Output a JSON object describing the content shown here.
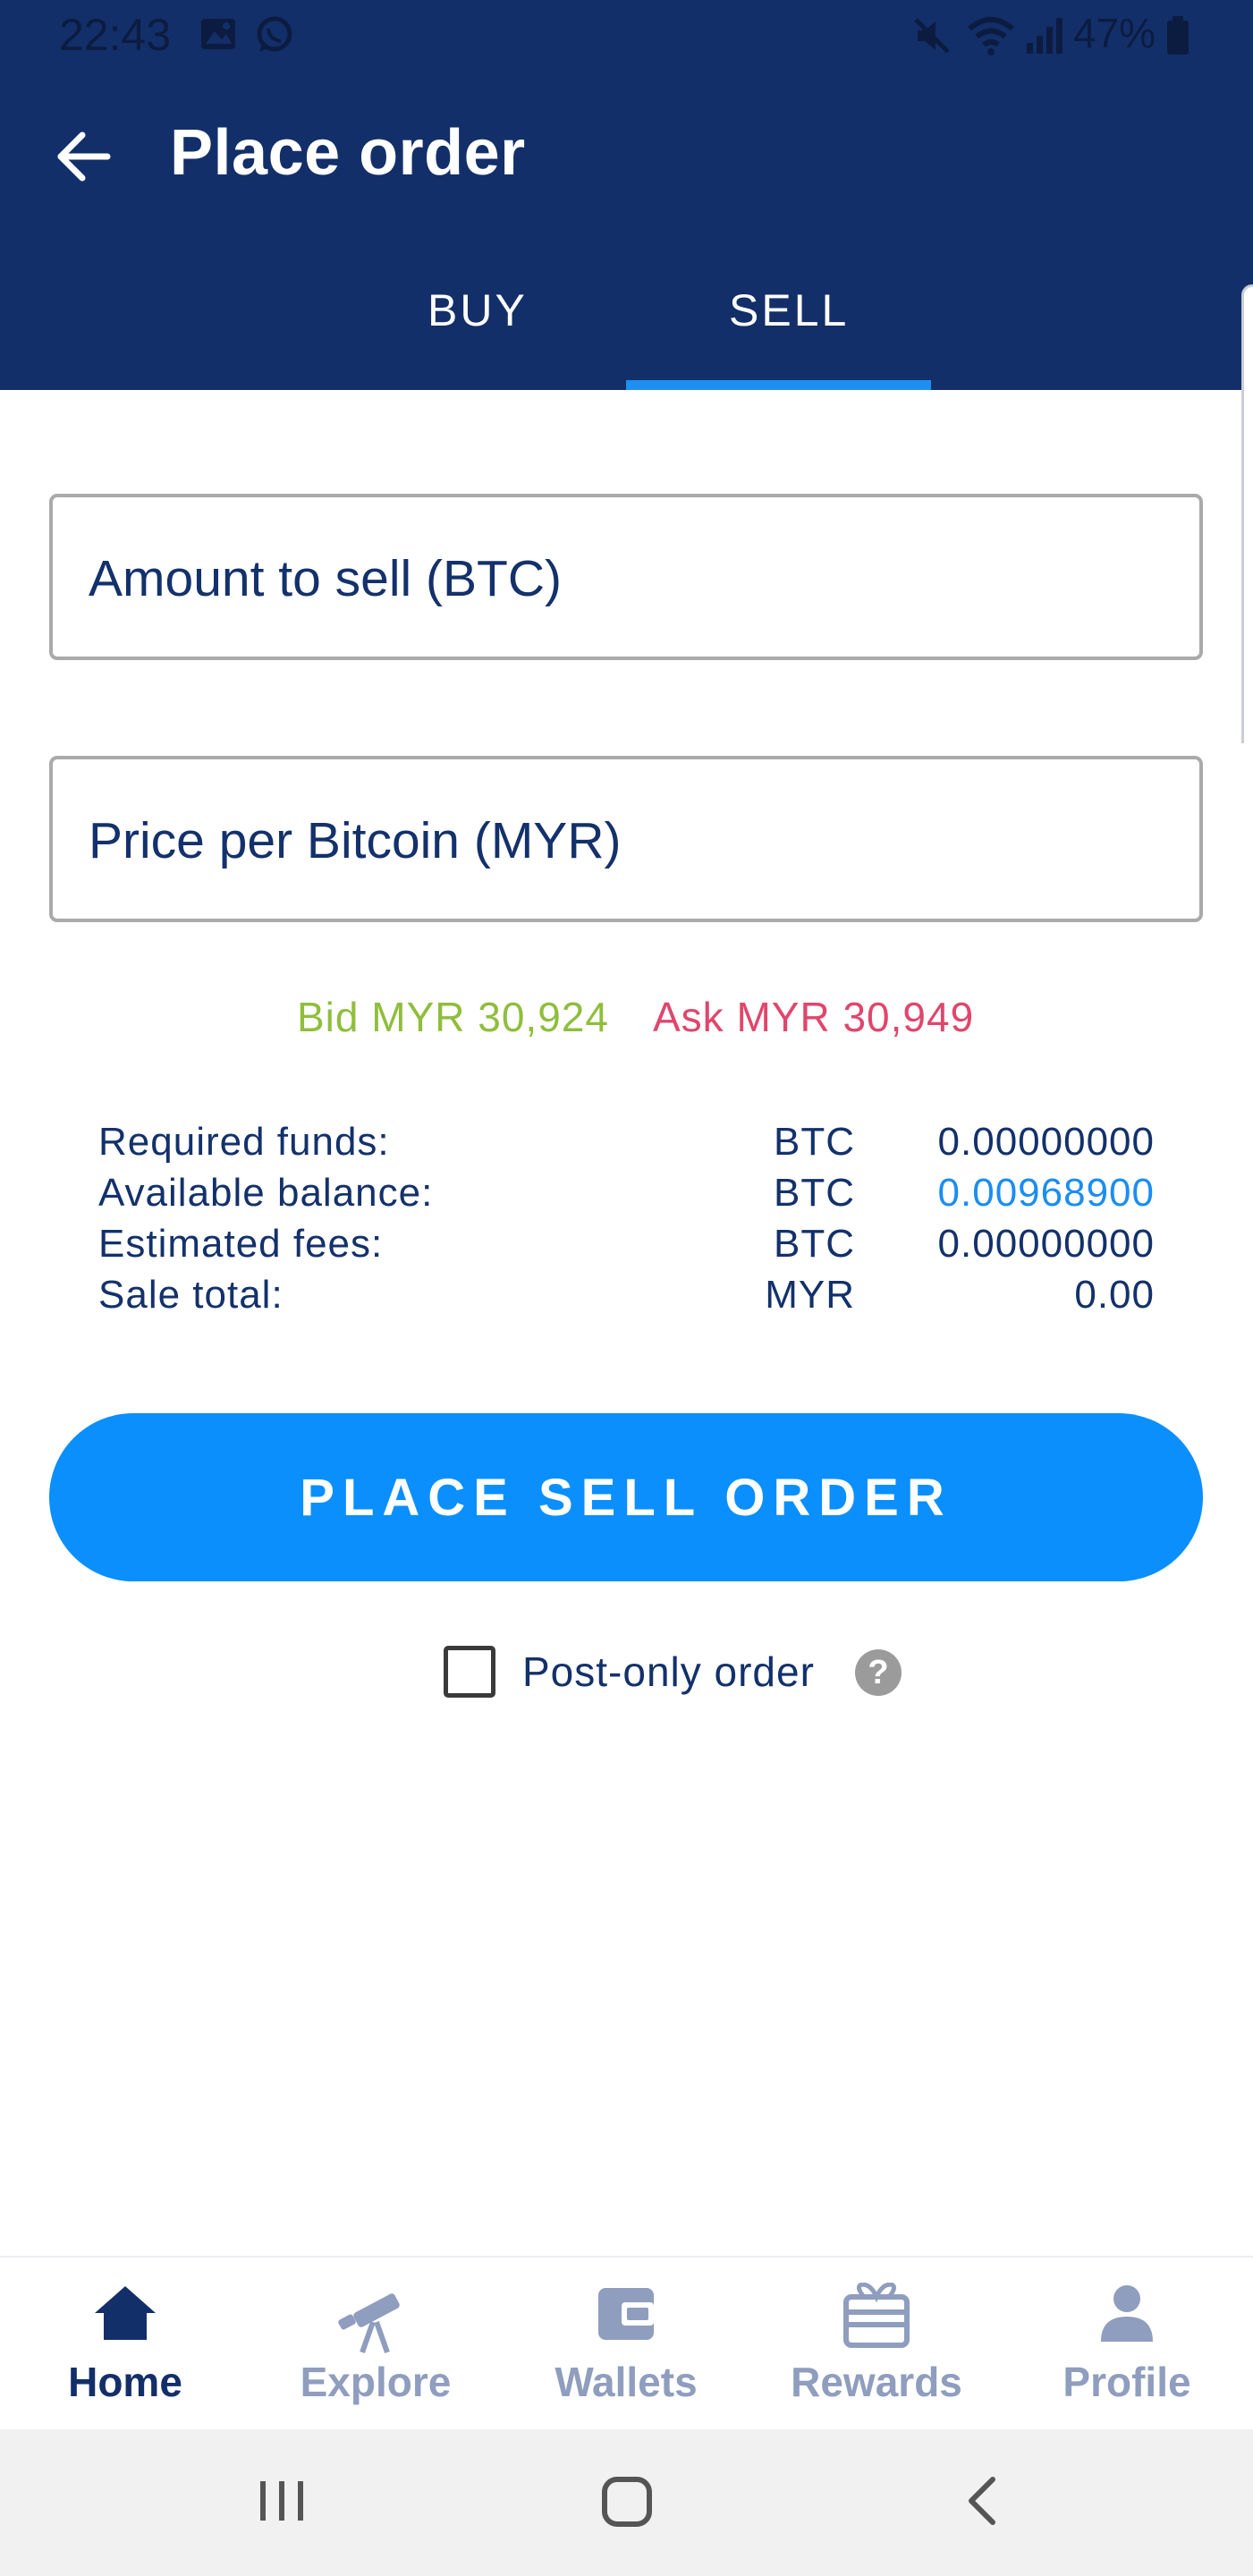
{
  "status_bar": {
    "time": "22:43",
    "battery": "47%",
    "icons": [
      "gallery-icon",
      "whatsapp-icon",
      "mute-icon",
      "wifi-icon",
      "signal-icon",
      "battery-icon"
    ]
  },
  "header": {
    "title": "Place order",
    "back_icon": "arrow-left-icon",
    "tabs": [
      {
        "label": "BUY",
        "active": false
      },
      {
        "label": "SELL",
        "active": true
      }
    ],
    "background_color": "#132f69",
    "indicator_color": "#1e8ff0"
  },
  "form": {
    "amount_placeholder": "Amount to sell (BTC)",
    "price_placeholder": "Price per Bitcoin (MYR)"
  },
  "quotes": {
    "bid": "Bid MYR 30,924",
    "ask": "Ask MYR 30,949",
    "bid_color": "#8fbe3c",
    "ask_color": "#e0466c"
  },
  "summary": [
    {
      "label": "Required funds:",
      "unit": "BTC",
      "value": "0.00000000"
    },
    {
      "label": "Available balance:",
      "unit": "BTC",
      "value": "0.00968900"
    },
    {
      "label": "Estimated fees:",
      "unit": "BTC",
      "value": "0.00000000"
    },
    {
      "label": "Sale total:",
      "unit": "MYR",
      "value": "0.00"
    }
  ],
  "cta": {
    "label": "PLACE SELL ORDER",
    "color": "#0a8ffd"
  },
  "post_only": {
    "label": "Post-only order",
    "checked": false,
    "help_icon": "question-circle-icon",
    "help_glyph": "?"
  },
  "bottom_nav": [
    {
      "label": "Home",
      "icon": "home-icon",
      "active": true
    },
    {
      "label": "Explore",
      "icon": "telescope-icon",
      "active": false
    },
    {
      "label": "Wallets",
      "icon": "wallet-icon",
      "active": false
    },
    {
      "label": "Rewards",
      "icon": "gift-icon",
      "active": false
    },
    {
      "label": "Profile",
      "icon": "person-icon",
      "active": false
    }
  ],
  "system_nav": [
    "recents-icon",
    "home-button-icon",
    "back-icon"
  ]
}
